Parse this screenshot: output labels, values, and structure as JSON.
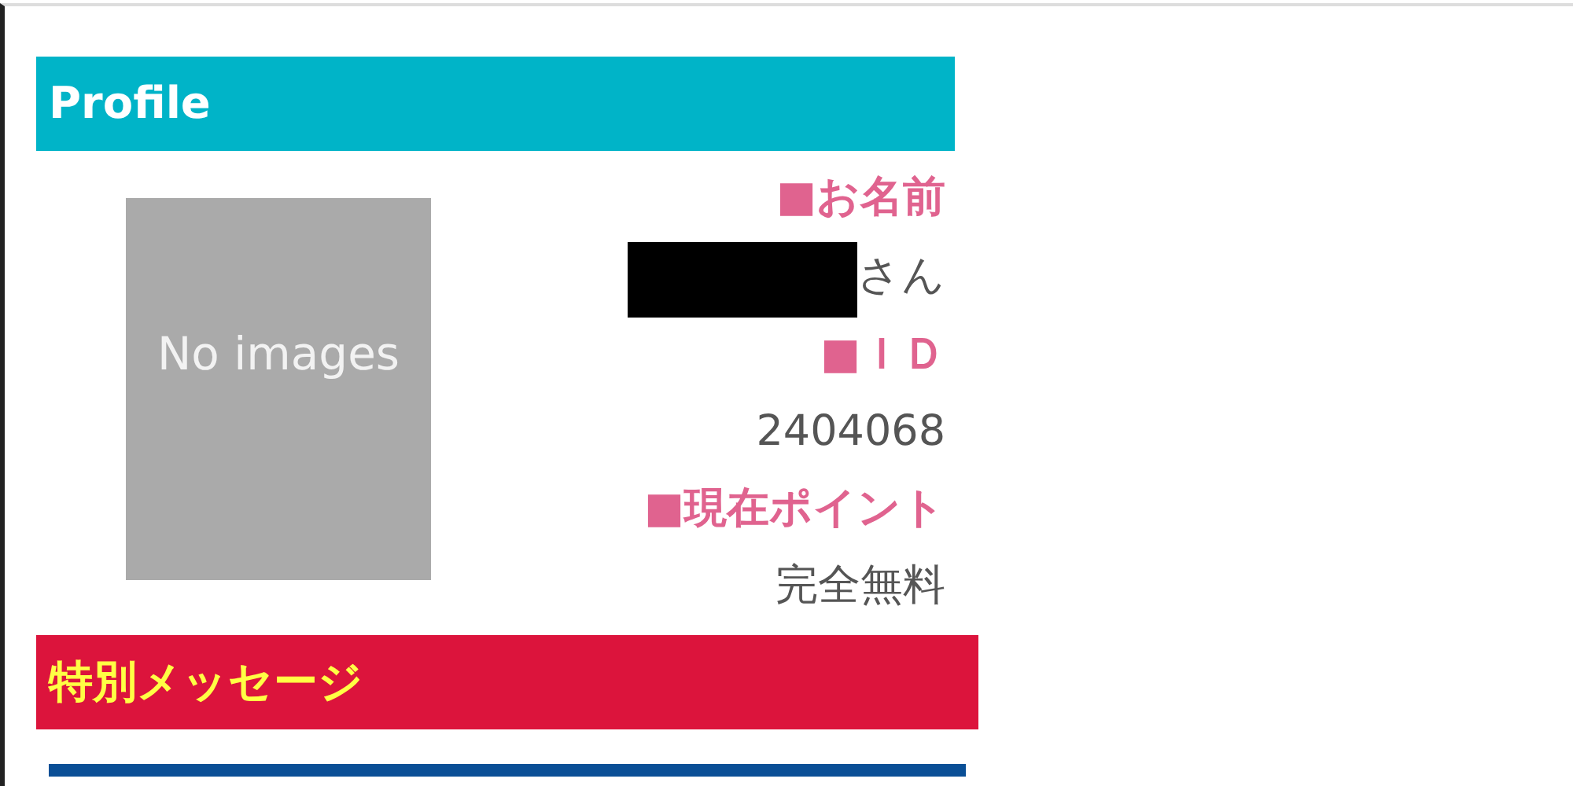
{
  "profile": {
    "title": "Profile",
    "image": {
      "text": "No images"
    },
    "fields": [
      {
        "label": "■お名前",
        "value": "さん",
        "redacted": true
      },
      {
        "label": "■ＩＤ",
        "value": "2404068",
        "redacted": false
      },
      {
        "label": "■現在ポイント",
        "value": "完全無料",
        "redacted": false
      }
    ]
  },
  "special_message": {
    "title": "特別メッセージ"
  },
  "next_section": {
    "kind": "bar"
  }
}
